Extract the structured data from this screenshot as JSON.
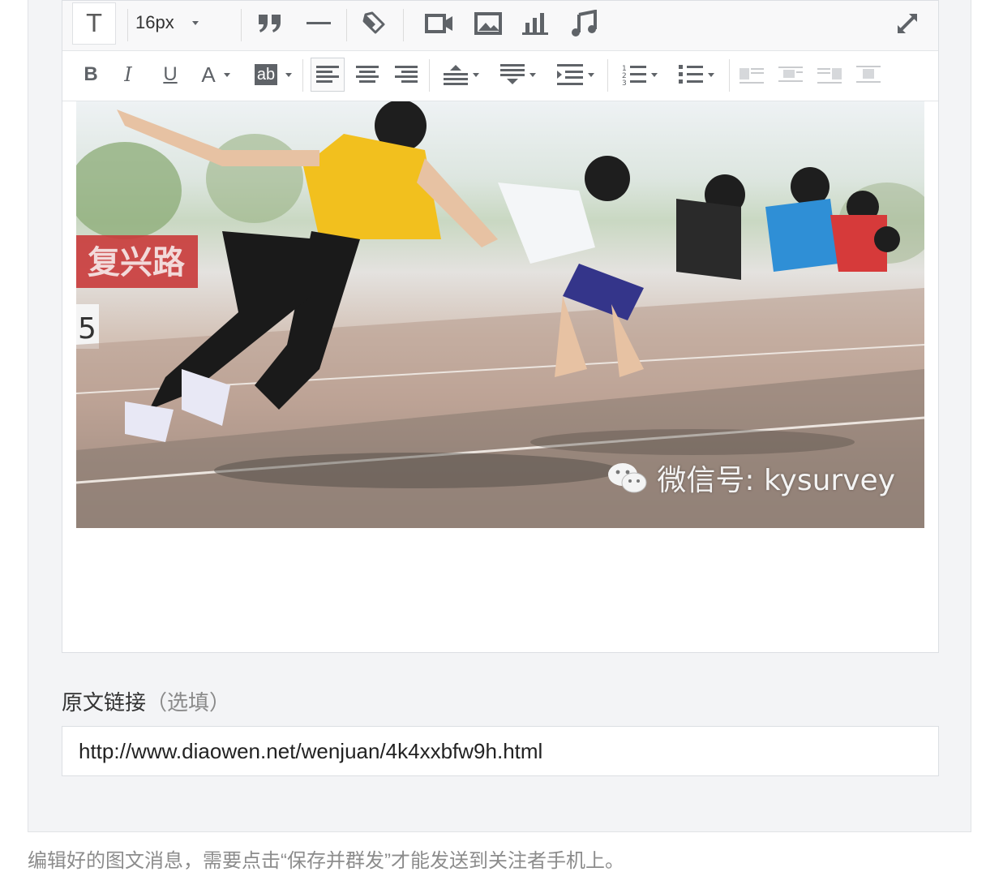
{
  "toolbar": {
    "font_icon_label": "T",
    "font_size": "16px",
    "bold_label": "B",
    "italic_label": "I",
    "underline_label": "U",
    "font_color_label": "A",
    "highlight_label": "ab"
  },
  "image": {
    "watermark_text": "微信号: kysurvey",
    "banner_text": "复兴路",
    "lane_number": "5"
  },
  "link_section": {
    "label": "原文链接",
    "optional_note": "（选填）",
    "url_value": "http://www.diaowen.net/wenjuan/4k4xxbfw9h.html"
  },
  "hint_text": "编辑好的图文消息，需要点击“保存并群发”才能发送到关注者手机上。"
}
